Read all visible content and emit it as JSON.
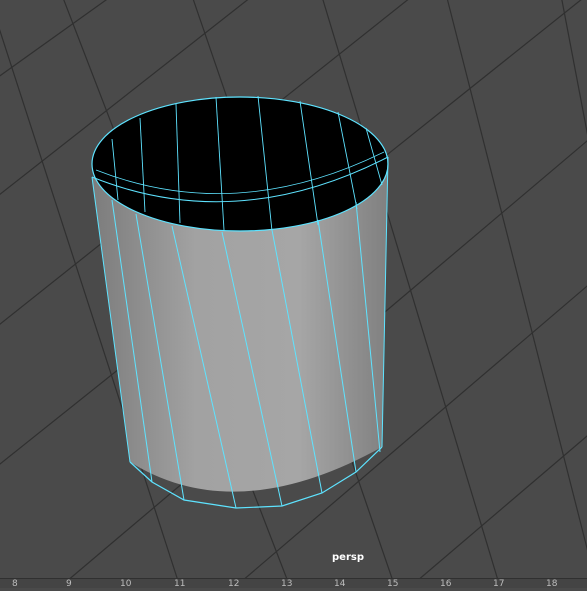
{
  "viewport": {
    "camera": "persp",
    "background_color": "#4a4a4a",
    "grid_color": "#303030",
    "wireframe_color": "#5ee3ff",
    "object": "polygon-cylinder"
  },
  "timeline": {
    "ticks": [
      "8",
      "9",
      "10",
      "11",
      "12",
      "13",
      "14",
      "15",
      "16",
      "17",
      "18"
    ]
  }
}
